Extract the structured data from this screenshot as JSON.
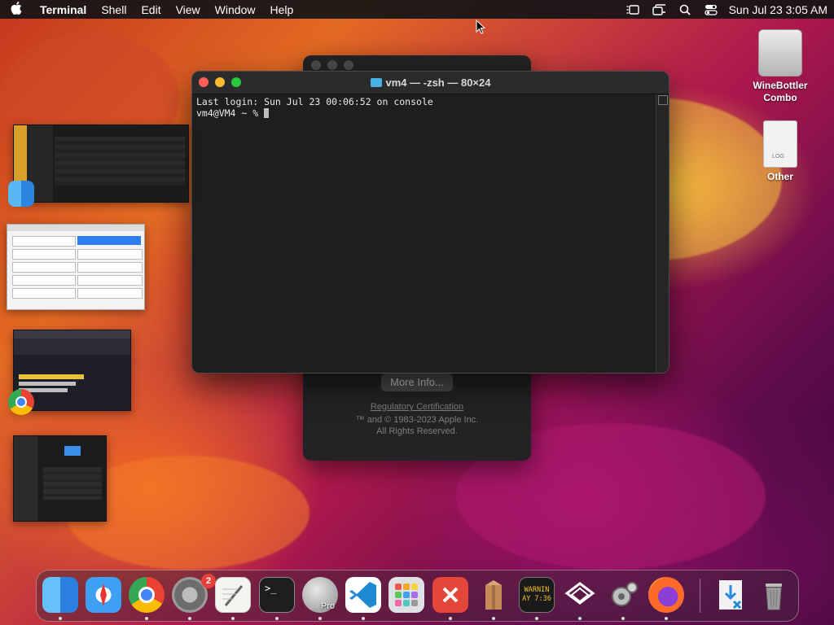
{
  "menubar": {
    "app_name": "Terminal",
    "menus": [
      "Shell",
      "Edit",
      "View",
      "Window",
      "Help"
    ],
    "clock": "Sun Jul 23  3:05 AM",
    "status_icons": [
      "stage-manager-icon",
      "screen-mirroring-icon",
      "search-icon",
      "control-center-icon"
    ]
  },
  "terminal": {
    "title": "vm4 — -zsh — 80×24",
    "line1": "Last login: Sun Jul 23 00:06:52 on console",
    "prompt": "vm4@VM4 ~ % "
  },
  "about_window": {
    "more_info": "More Info...",
    "regulatory": "Regulatory Certification",
    "copyright_line1": "™ and © 1983-2023 Apple Inc.",
    "copyright_line2": "All Rights Reserved."
  },
  "desktop": {
    "icon1_label": "WineBottler Combo",
    "icon2_label": "Other"
  },
  "dock": {
    "apps": [
      "Finder",
      "Safari",
      "Google Chrome",
      "System Settings",
      "TextEdit",
      "Terminal",
      "Server Pro",
      "Visual Studio Code",
      "Launchpad",
      "Remote Desktop",
      "Archive Utility",
      "Console",
      "VMware Fusion",
      "Automator",
      "Firefox",
      "Downloads",
      "Trash"
    ],
    "settings_badge": "2",
    "console_text": "WARNIN\nAY 7:36"
  }
}
